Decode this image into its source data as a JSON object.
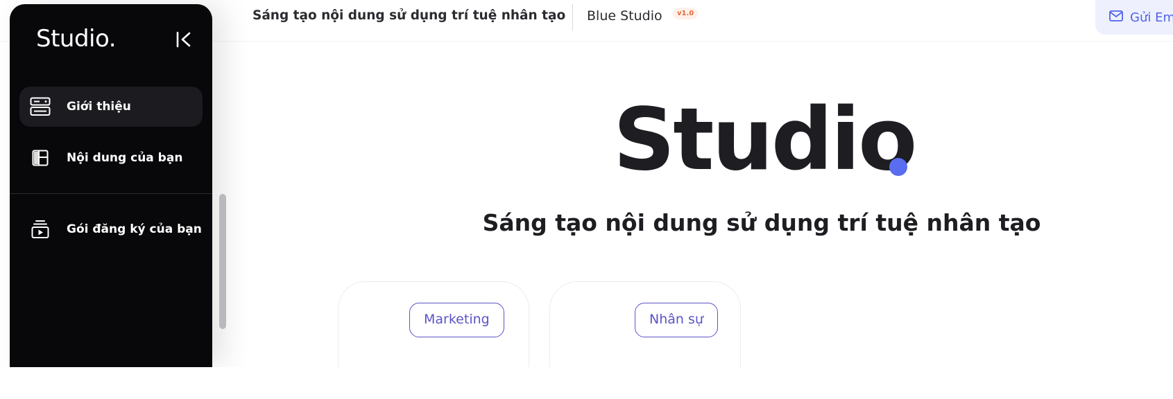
{
  "sidebar": {
    "brand": "Studio.",
    "items": [
      {
        "label": "Giới thiệu",
        "icon": "server-icon",
        "active": true
      },
      {
        "label": "Nội dung của bạn",
        "icon": "layout-icon",
        "active": false
      },
      {
        "label": "Gói đăng ký của bạn",
        "icon": "subscription-icon",
        "active": false
      }
    ]
  },
  "header": {
    "title": "Sáng tạo nội dung sử dụng trí tuệ nhân tạo",
    "app_name": "Blue Studio",
    "version": "v1.0",
    "email_button": "Gửi Em"
  },
  "hero": {
    "logo": "Studio",
    "subtitle": "Sáng tạo nội dung sử dụng trí tuệ nhân tạo"
  },
  "cards": [
    {
      "tag": "Marketing"
    },
    {
      "tag": "Nhân sự"
    }
  ],
  "colors": {
    "accent": "#5a6cf0",
    "sidebar_bg": "#08080b",
    "tag_color": "#5c53c7",
    "badge_text": "#e2683a"
  }
}
